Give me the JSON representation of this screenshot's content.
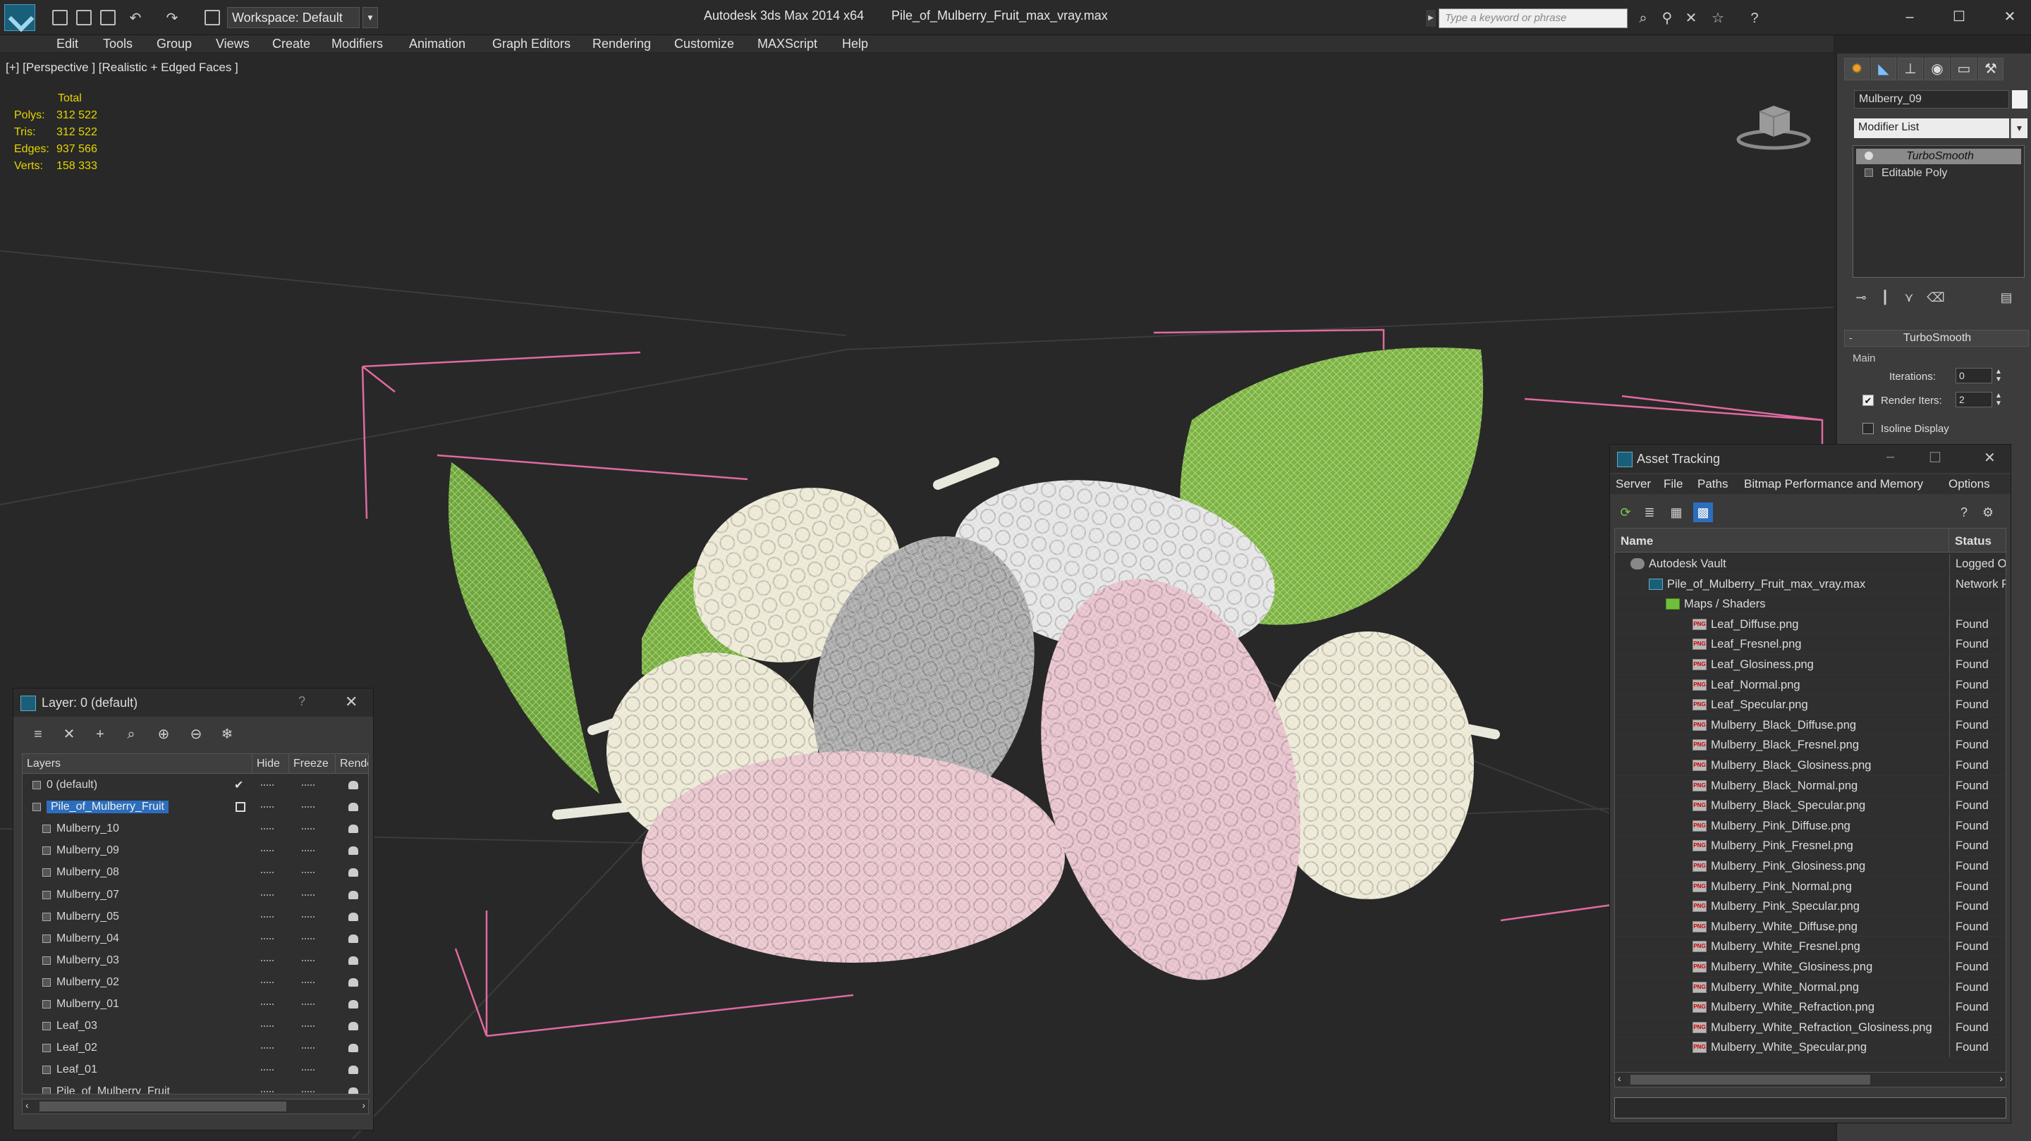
{
  "titlebar": {
    "workspace": "Workspace: Default",
    "app_title": "Autodesk 3ds Max  2014 x64",
    "file_title": "Pile_of_Mulberry_Fruit_max_vray.max",
    "search_placeholder": "Type a keyword or phrase"
  },
  "menu": [
    "Edit",
    "Tools",
    "Group",
    "Views",
    "Create",
    "Modifiers",
    "Animation",
    "Graph Editors",
    "Rendering",
    "Customize",
    "MAXScript",
    "Help"
  ],
  "viewport": {
    "label": "[+] [Perspective ] [Realistic + Edged Faces ]",
    "stats_header": "Total",
    "stats": [
      {
        "label": "Polys:",
        "value": "312 522"
      },
      {
        "label": "Tris:",
        "value": "312 522"
      },
      {
        "label": "Edges:",
        "value": "937 566"
      },
      {
        "label": "Verts:",
        "value": "158 333"
      }
    ]
  },
  "command_panel": {
    "object_name": "Mulberry_09",
    "modifier_list": "Modifier List",
    "stack": [
      "TurboSmooth",
      "Editable Poly"
    ],
    "rollout_title": "TurboSmooth",
    "group_main": "Main",
    "iterations_label": "Iterations:",
    "iterations_value": "0",
    "render_iters_label": "Render Iters:",
    "render_iters_value": "2",
    "isoline_label": "Isoline Display"
  },
  "layer_dialog": {
    "title": "Layer: 0 (default)",
    "help": "?",
    "columns": [
      "Layers",
      "Hide",
      "Freeze",
      "Rende"
    ],
    "rows": [
      {
        "name": "0 (default)",
        "indent": 0
      },
      {
        "name": "Pile_of_Mulberry_Fruit",
        "indent": 0,
        "selected": true
      },
      {
        "name": "Mulberry_10",
        "indent": 1
      },
      {
        "name": "Mulberry_09",
        "indent": 1
      },
      {
        "name": "Mulberry_08",
        "indent": 1
      },
      {
        "name": "Mulberry_07",
        "indent": 1
      },
      {
        "name": "Mulberry_05",
        "indent": 1
      },
      {
        "name": "Mulberry_04",
        "indent": 1
      },
      {
        "name": "Mulberry_03",
        "indent": 1
      },
      {
        "name": "Mulberry_02",
        "indent": 1
      },
      {
        "name": "Mulberry_01",
        "indent": 1
      },
      {
        "name": "Leaf_03",
        "indent": 1
      },
      {
        "name": "Leaf_02",
        "indent": 1
      },
      {
        "name": "Leaf_01",
        "indent": 1
      },
      {
        "name": "Pile_of_Mulberry_Fruit",
        "indent": 1
      }
    ]
  },
  "asset_tracking": {
    "title": "Asset Tracking",
    "menu": [
      "Server",
      "File",
      "Paths",
      "Bitmap Performance and Memory",
      "Options"
    ],
    "columns": [
      "Name",
      "Status"
    ],
    "rows": [
      {
        "name": "Autodesk Vault",
        "status": "Logged O",
        "level": 0,
        "kind": "vault"
      },
      {
        "name": "Pile_of_Mulberry_Fruit_max_vray.max",
        "status": "Network P",
        "level": 1,
        "kind": "max"
      },
      {
        "name": "Maps / Shaders",
        "status": "",
        "level": 2,
        "kind": "maps"
      },
      {
        "name": "Leaf_Diffuse.png",
        "status": "Found",
        "level": 3,
        "kind": "png"
      },
      {
        "name": "Leaf_Fresnel.png",
        "status": "Found",
        "level": 3,
        "kind": "png"
      },
      {
        "name": "Leaf_Glosiness.png",
        "status": "Found",
        "level": 3,
        "kind": "png"
      },
      {
        "name": "Leaf_Normal.png",
        "status": "Found",
        "level": 3,
        "kind": "png"
      },
      {
        "name": "Leaf_Specular.png",
        "status": "Found",
        "level": 3,
        "kind": "png"
      },
      {
        "name": "Mulberry_Black_Diffuse.png",
        "status": "Found",
        "level": 3,
        "kind": "png"
      },
      {
        "name": "Mulberry_Black_Fresnel.png",
        "status": "Found",
        "level": 3,
        "kind": "png"
      },
      {
        "name": "Mulberry_Black_Glosiness.png",
        "status": "Found",
        "level": 3,
        "kind": "png"
      },
      {
        "name": "Mulberry_Black_Normal.png",
        "status": "Found",
        "level": 3,
        "kind": "png"
      },
      {
        "name": "Mulberry_Black_Specular.png",
        "status": "Found",
        "level": 3,
        "kind": "png"
      },
      {
        "name": "Mulberry_Pink_Diffuse.png",
        "status": "Found",
        "level": 3,
        "kind": "png"
      },
      {
        "name": "Mulberry_Pink_Fresnel.png",
        "status": "Found",
        "level": 3,
        "kind": "png"
      },
      {
        "name": "Mulberry_Pink_Glosiness.png",
        "status": "Found",
        "level": 3,
        "kind": "png"
      },
      {
        "name": "Mulberry_Pink_Normal.png",
        "status": "Found",
        "level": 3,
        "kind": "png"
      },
      {
        "name": "Mulberry_Pink_Specular.png",
        "status": "Found",
        "level": 3,
        "kind": "png"
      },
      {
        "name": "Mulberry_White_Diffuse.png",
        "status": "Found",
        "level": 3,
        "kind": "png"
      },
      {
        "name": "Mulberry_White_Fresnel.png",
        "status": "Found",
        "level": 3,
        "kind": "png"
      },
      {
        "name": "Mulberry_White_Glosiness.png",
        "status": "Found",
        "level": 3,
        "kind": "png"
      },
      {
        "name": "Mulberry_White_Normal.png",
        "status": "Found",
        "level": 3,
        "kind": "png"
      },
      {
        "name": "Mulberry_White_Refraction.png",
        "status": "Found",
        "level": 3,
        "kind": "png"
      },
      {
        "name": "Mulberry_White_Refraction_Glosiness.png",
        "status": "Found",
        "level": 3,
        "kind": "png"
      },
      {
        "name": "Mulberry_White_Specular.png",
        "status": "Found",
        "level": 3,
        "kind": "png"
      }
    ]
  },
  "icon_badge": "PNG",
  "colors": {
    "accent": "#2c6ebd",
    "stats": "#e6d600",
    "leaf": "#7cb342",
    "pink": "#e8c4cc",
    "white_fruit": "#ece8d4"
  }
}
